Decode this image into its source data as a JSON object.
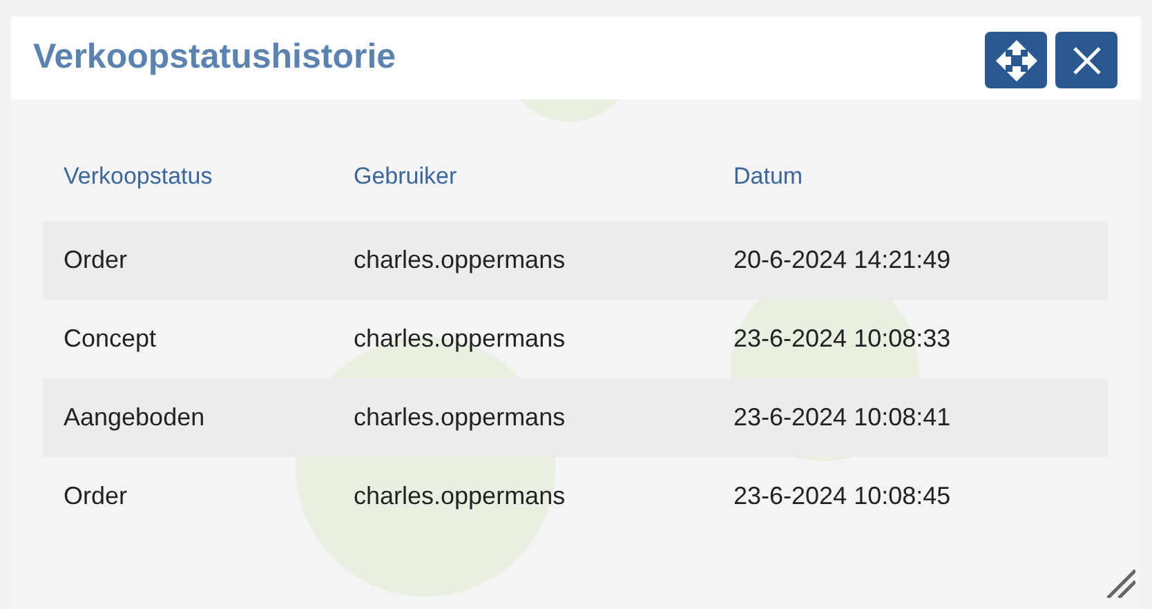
{
  "dialog": {
    "title": "Verkoopstatushistorie"
  },
  "table": {
    "columns": [
      "Verkoopstatus",
      "Gebruiker",
      "Datum"
    ],
    "rows": [
      {
        "cells": [
          "Order",
          "charles.oppermans",
          "20-6-2024 14:21:49"
        ]
      },
      {
        "cells": [
          "Concept",
          "charles.oppermans",
          "23-6-2024 10:08:33"
        ]
      },
      {
        "cells": [
          "Aangeboden",
          "charles.oppermans",
          "23-6-2024 10:08:41"
        ]
      },
      {
        "cells": [
          "Order",
          "charles.oppermans",
          "23-6-2024 10:08:45"
        ]
      }
    ]
  }
}
